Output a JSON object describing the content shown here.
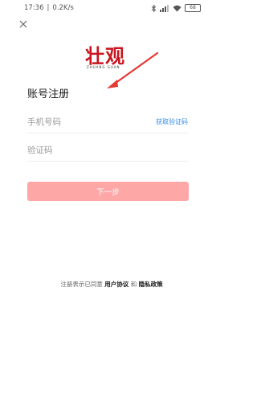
{
  "status_bar": {
    "time": "17:36",
    "network_speed": "0.2K/s",
    "battery": "68",
    "icons": [
      "bluetooth-icon",
      "signal-icon",
      "wifi-icon",
      "battery-icon"
    ]
  },
  "header": {
    "close_icon": "close-icon"
  },
  "logo": {
    "text": "壮观",
    "subtitle": "ZHUANG GUAN"
  },
  "page": {
    "title": "账号注册"
  },
  "form": {
    "phone_placeholder": "手机号码",
    "phone_value": "",
    "get_code_label": "获取验证码",
    "code_placeholder": "验证码",
    "code_value": "",
    "next_label": "下一步"
  },
  "agreement": {
    "prefix": "注册表示已同意",
    "user_agreement": "用户协议",
    "conjunction": "和",
    "privacy_policy": "隐私政策"
  },
  "colors": {
    "accent_link": "#3a8ee6",
    "button_bg": "#fda7a7",
    "logo_red": "#c8141e",
    "arrow_red": "#e53935"
  }
}
